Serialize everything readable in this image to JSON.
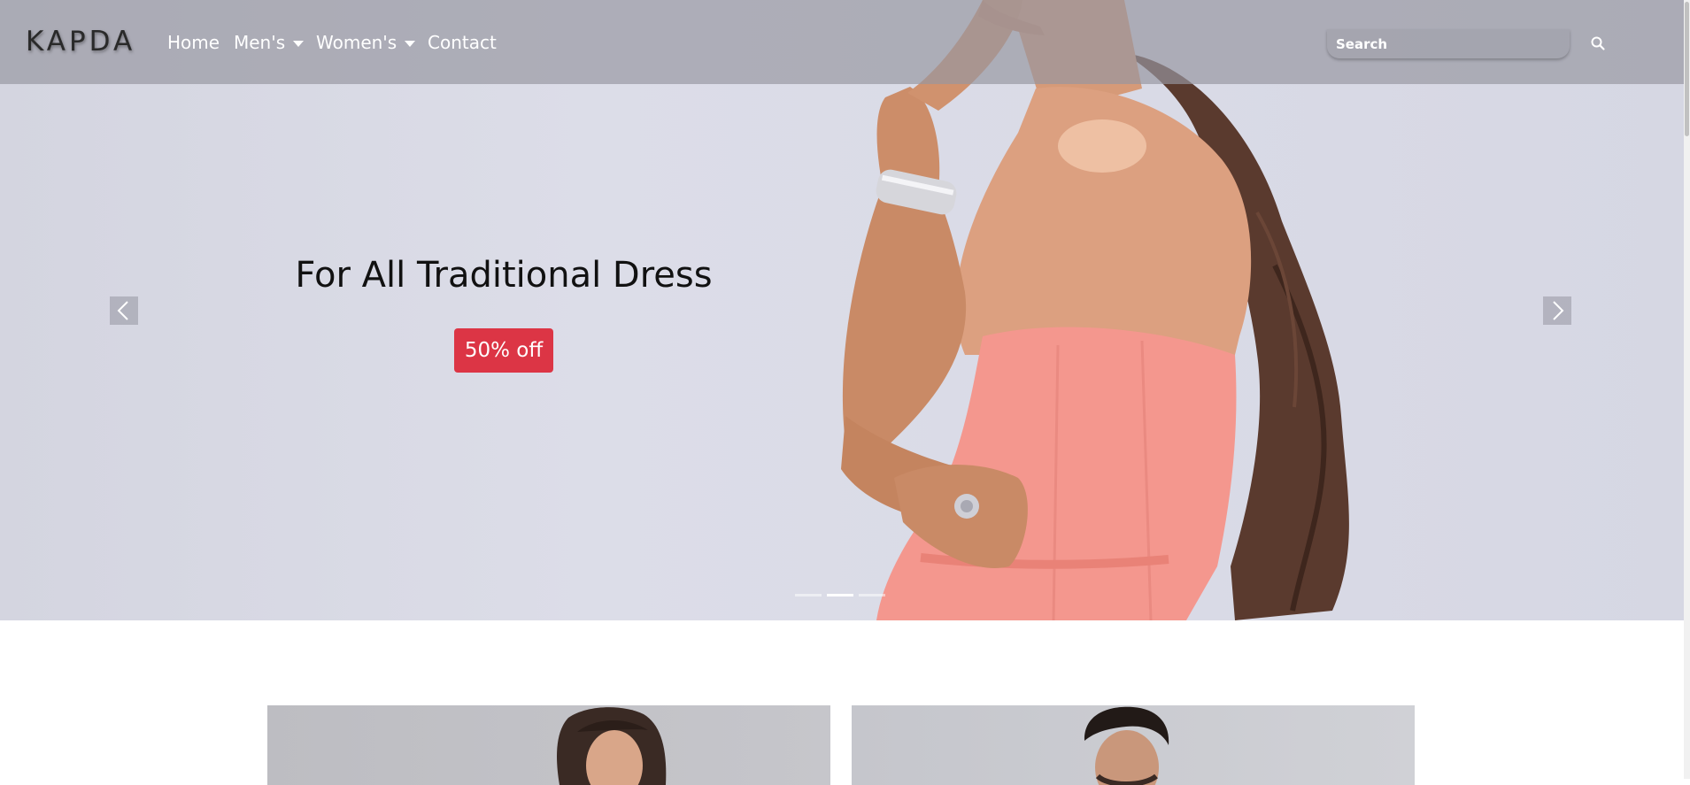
{
  "navbar": {
    "brand": "KAPDA",
    "items": [
      {
        "label": "Home"
      },
      {
        "label": "Men's"
      },
      {
        "label": "Women's"
      },
      {
        "label": "Contact"
      }
    ],
    "search": {
      "placeholder": "Search",
      "value": "",
      "icon": "search-icon"
    }
  },
  "hero": {
    "title": "For All Traditional Dress",
    "offer_label": "50% off",
    "controls": {
      "prev_icon": "chevron-left-icon",
      "next_icon": "chevron-right-icon"
    },
    "slides_count": 3,
    "active_slide": 2
  },
  "cards": [
    {
      "category": "women"
    },
    {
      "category": "men"
    }
  ],
  "colors": {
    "offer_badge": "#dc3545",
    "navbar_overlay": "#9696a0",
    "hero_background": "#dcdde8",
    "dress": "#f4978e"
  }
}
